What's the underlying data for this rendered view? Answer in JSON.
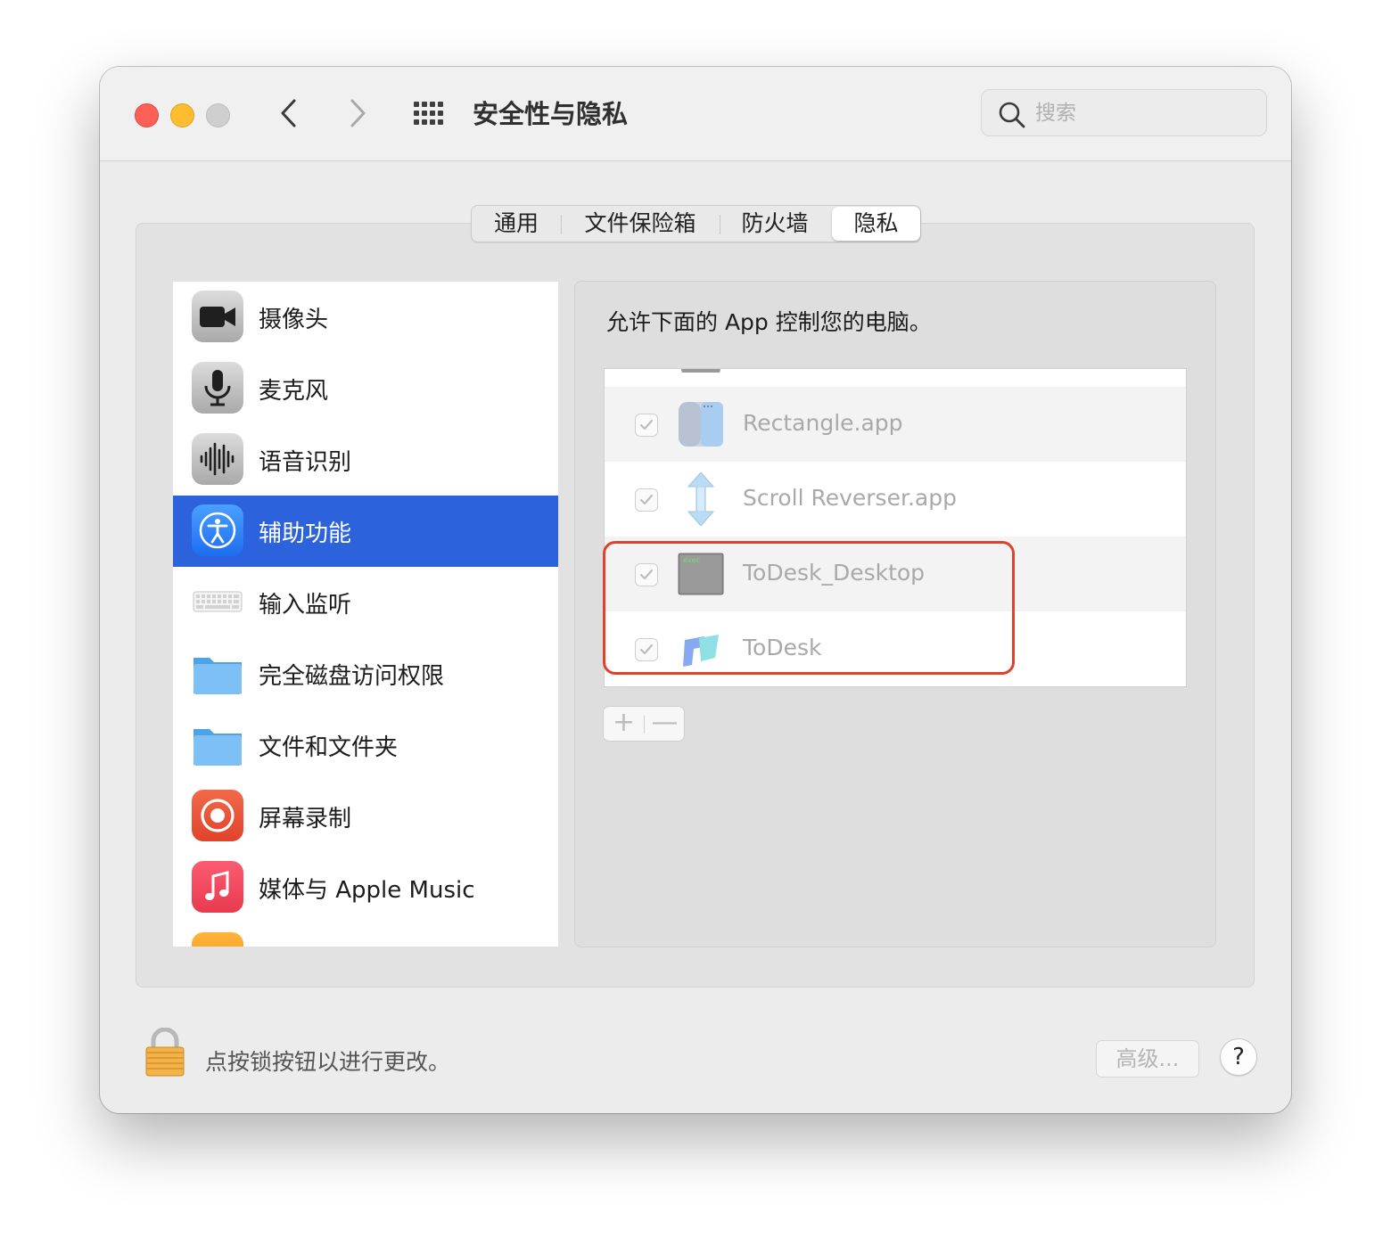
{
  "window": {
    "title": "安全性与隐私",
    "search_placeholder": "搜索"
  },
  "tabs": [
    {
      "label": "通用"
    },
    {
      "label": "文件保险箱"
    },
    {
      "label": "防火墙"
    },
    {
      "label": "隐私",
      "selected": true
    }
  ],
  "sidebar": {
    "items": [
      {
        "label": "摄像头",
        "icon": "camera-icon"
      },
      {
        "label": "麦克风",
        "icon": "microphone-icon"
      },
      {
        "label": "语音识别",
        "icon": "speech-recognition-icon"
      },
      {
        "label": "辅助功能",
        "icon": "accessibility-icon",
        "selected": true
      },
      {
        "label": "输入监听",
        "icon": "keyboard-icon"
      },
      {
        "label": "完全磁盘访问权限",
        "icon": "folder-icon"
      },
      {
        "label": "文件和文件夹",
        "icon": "folder-icon"
      },
      {
        "label": "屏幕录制",
        "icon": "screen-recording-icon"
      },
      {
        "label": "媒体与 Apple Music",
        "icon": "music-icon"
      }
    ]
  },
  "panel": {
    "description": "允许下面的 App 控制您的电脑。",
    "apps": [
      {
        "name": "Rectangle.app",
        "checked": true,
        "icon": "rectangle-app-icon"
      },
      {
        "name": "Scroll Reverser.app",
        "checked": true,
        "icon": "scroll-reverser-icon"
      },
      {
        "name": "ToDesk_Desktop",
        "checked": true,
        "icon": "exec-terminal-icon",
        "icon_text": "exec"
      },
      {
        "name": "ToDesk",
        "checked": true,
        "icon": "todesk-icon"
      }
    ],
    "add_label": "+",
    "remove_label": "—"
  },
  "footer": {
    "lock_text": "点按锁按钮以进行更改。",
    "advanced_label": "高级...",
    "help_label": "?"
  },
  "colors": {
    "selection": "#2c62db",
    "highlight_box": "#e0412b"
  }
}
